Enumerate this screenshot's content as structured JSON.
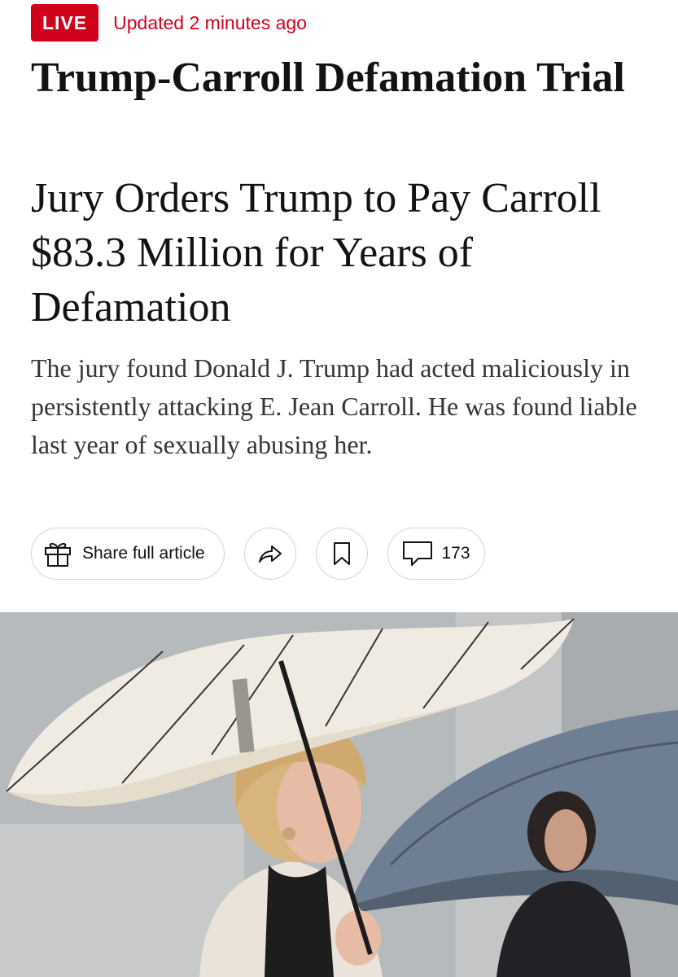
{
  "header": {
    "live_label": "LIVE",
    "updated_text": "Updated 2 minutes ago"
  },
  "article": {
    "kicker": "Trump-Carroll Defamation Trial",
    "headline": "Jury Orders Trump to Pay Carroll $83.3 Million for Years of Defamation",
    "summary": "The jury found Donald J. Trump had acted maliciously in persistently attacking E. Jean Carroll. He was found liable last year of sexually abusing her."
  },
  "actions": {
    "share_full_article_label": "Share full article",
    "share_icon": "share-arrow-icon",
    "gift_icon": "gift-icon",
    "bookmark_icon": "bookmark-icon",
    "comment_icon": "comment-bubble-icon",
    "comment_count": "173"
  },
  "colors": {
    "live_red": "#d0021b",
    "text": "#121212",
    "border": "#d4d4d4"
  }
}
